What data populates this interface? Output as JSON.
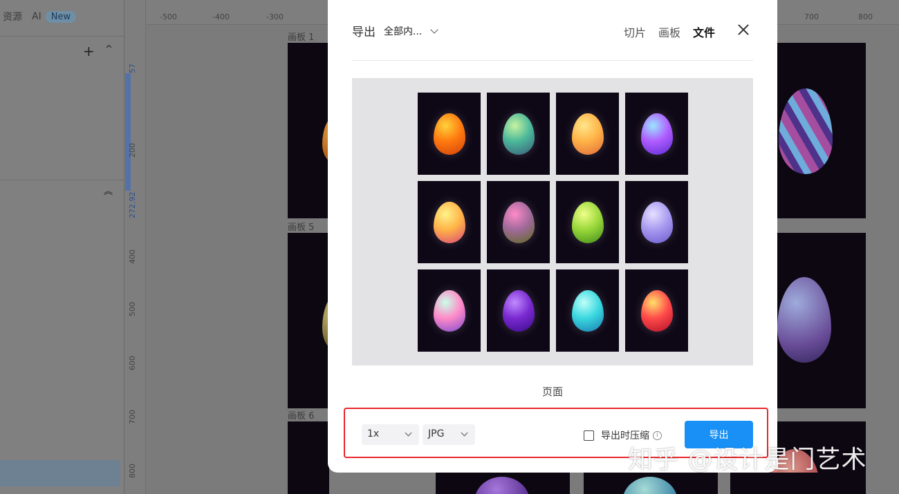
{
  "left_panel": {
    "tabs": [
      {
        "label": "资源"
      },
      {
        "label": "AI"
      }
    ],
    "ai_badge": "New",
    "add_icon": "+",
    "collapse_icon": "^",
    "double_caret": "︽"
  },
  "vertical_ruler": {
    "labels": [
      "57",
      "200",
      "272.92",
      "400",
      "500",
      "600",
      "700",
      "800"
    ]
  },
  "horizontal_ruler": {
    "labels": [
      "-500",
      "-400",
      "-300",
      "700",
      "800"
    ]
  },
  "canvas": {
    "artboards": [
      "画板 1",
      "画板 5",
      "画板 6"
    ]
  },
  "modal": {
    "title": "导出",
    "scope": "全部内...",
    "tabs": [
      {
        "label": "切片",
        "active": false
      },
      {
        "label": "画板",
        "active": false
      },
      {
        "label": "文件",
        "active": true
      }
    ],
    "preview_caption": "页面",
    "scale_select": "1x",
    "format_select": "JPG",
    "compress_label": "导出时压缩",
    "compress_checked": false,
    "export_button": "导出",
    "accent_color": "#1890f5",
    "highlight_color": "#e8262a"
  },
  "preview_eggs": [
    {
      "name": "orange-crystal-egg",
      "colors": [
        "#ffd23a",
        "#ff7a10",
        "#d0400a"
      ]
    },
    {
      "name": "teal-scaled-egg",
      "colors": [
        "#c6f2a0",
        "#4bb89a",
        "#3a5a7a"
      ]
    },
    {
      "name": "golden-swirl-egg",
      "colors": [
        "#ffe68a",
        "#ffb347",
        "#e06a3c"
      ]
    },
    {
      "name": "purple-blue-swirl-egg",
      "colors": [
        "#9ae6ff",
        "#b05cff",
        "#5a2bd0"
      ]
    },
    {
      "name": "yellow-pink-egg",
      "colors": [
        "#fff38a",
        "#ffb347",
        "#d9457a"
      ]
    },
    {
      "name": "pink-olive-egg",
      "colors": [
        "#ff8ac8",
        "#a06a9a",
        "#5d6a20"
      ]
    },
    {
      "name": "lime-green-egg",
      "colors": [
        "#f0ff8a",
        "#9ad83a",
        "#3f8a1a"
      ]
    },
    {
      "name": "lavender-egg",
      "colors": [
        "#e6e0ff",
        "#a89af0",
        "#6a5acd"
      ]
    },
    {
      "name": "rainbow-swirl-egg",
      "colors": [
        "#c8ffe8",
        "#ff8ac8",
        "#7a4ad0"
      ]
    },
    {
      "name": "violet-swirl-egg",
      "colors": [
        "#c08aff",
        "#7a2ad0",
        "#3a0a8a"
      ]
    },
    {
      "name": "cyan-crystal-egg",
      "colors": [
        "#c0fff8",
        "#3ad8e0",
        "#1a7ab0"
      ]
    },
    {
      "name": "red-gold-egg",
      "colors": [
        "#ffe06a",
        "#ff4a4a",
        "#b0102a"
      ]
    }
  ],
  "watermark": "知乎 @设计是门艺术"
}
